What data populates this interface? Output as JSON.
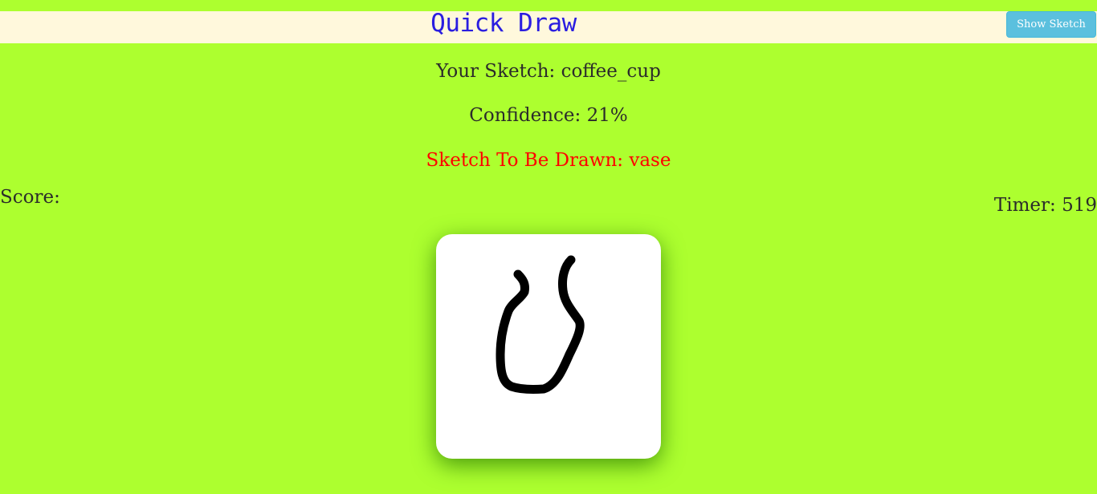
{
  "header": {
    "title": "Quick Draw",
    "show_sketch_label": "Show Sketch"
  },
  "status": {
    "your_sketch": "Your Sketch: coffee_cup",
    "confidence": "Confidence: 21%",
    "target": "Sketch To Be Drawn: vase",
    "score": "Score:",
    "timer": "Timer: 519"
  },
  "colors": {
    "background": "#adff2f",
    "title": "#2a1de0",
    "target_text": "#ff0000",
    "button": "#5bc0de",
    "header_bar": "#fff8dc",
    "stroke": "#000000"
  }
}
